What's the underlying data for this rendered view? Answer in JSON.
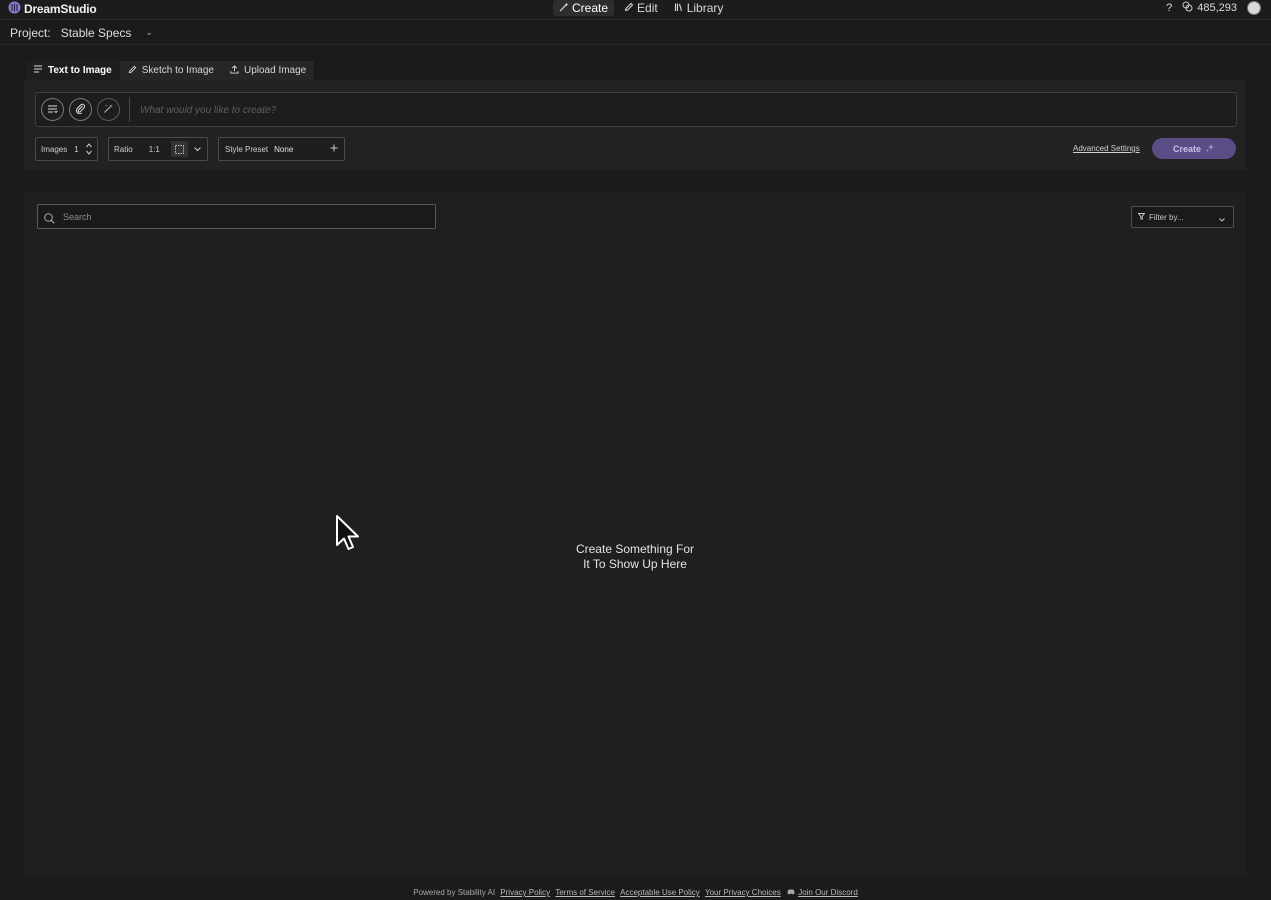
{
  "app": {
    "name": "DreamStudio"
  },
  "topnav": {
    "items": [
      {
        "label": "Create"
      },
      {
        "label": "Edit"
      },
      {
        "label": "Library"
      }
    ],
    "help": "?",
    "credits": "485,293"
  },
  "project": {
    "label": "Project:",
    "name": "Stable Specs"
  },
  "tabs": [
    {
      "label": "Text to Image"
    },
    {
      "label": "Sketch to Image"
    },
    {
      "label": "Upload Image"
    }
  ],
  "prompt": {
    "placeholder": "What would you like to create?"
  },
  "controls": {
    "images_label": "Images",
    "images_value": "1",
    "ratio_label": "Ratio",
    "ratio_value": "1:1",
    "style_label": "Style Preset",
    "style_value": "None",
    "advanced_label": "Advanced Settings",
    "create_label": "Create"
  },
  "gallery": {
    "search_placeholder": "Search",
    "filter_placeholder": "Filter by...",
    "empty_line1": "Create Something For",
    "empty_line2": "It To Show Up Here"
  },
  "footer": {
    "powered": "Powered by Stability AI",
    "links": [
      "Privacy Policy",
      "Terms of Service",
      "Acceptable Use Policy",
      "Your Privacy Choices",
      "Join Our Discord"
    ]
  },
  "colors": {
    "background": "#1b1b1b",
    "panel": "#222222",
    "accent": "#5a4d86"
  }
}
